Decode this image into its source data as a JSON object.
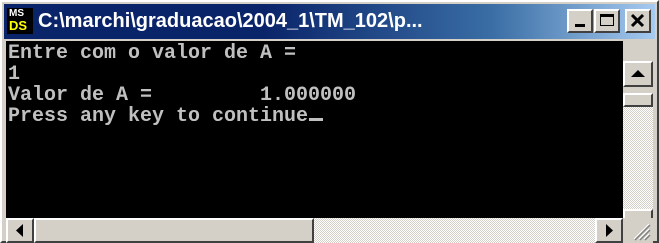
{
  "window": {
    "title": "C:\\marchi\\graduacao\\2004_1\\TM_102\\p...",
    "icon": "ms-dos-icon",
    "icon_text_top": "MS",
    "icon_text_bottom": "DS"
  },
  "console": {
    "lines": [
      "Entre com o valor de A =",
      "1",
      "Valor de A =         1.000000",
      "Press any key to continue"
    ],
    "text_color": "#c0c0c0",
    "background": "#000000"
  },
  "colors": {
    "titlebar_start": "#0a246a",
    "titlebar_end": "#a6caf0",
    "chrome": "#d4d0c8"
  }
}
